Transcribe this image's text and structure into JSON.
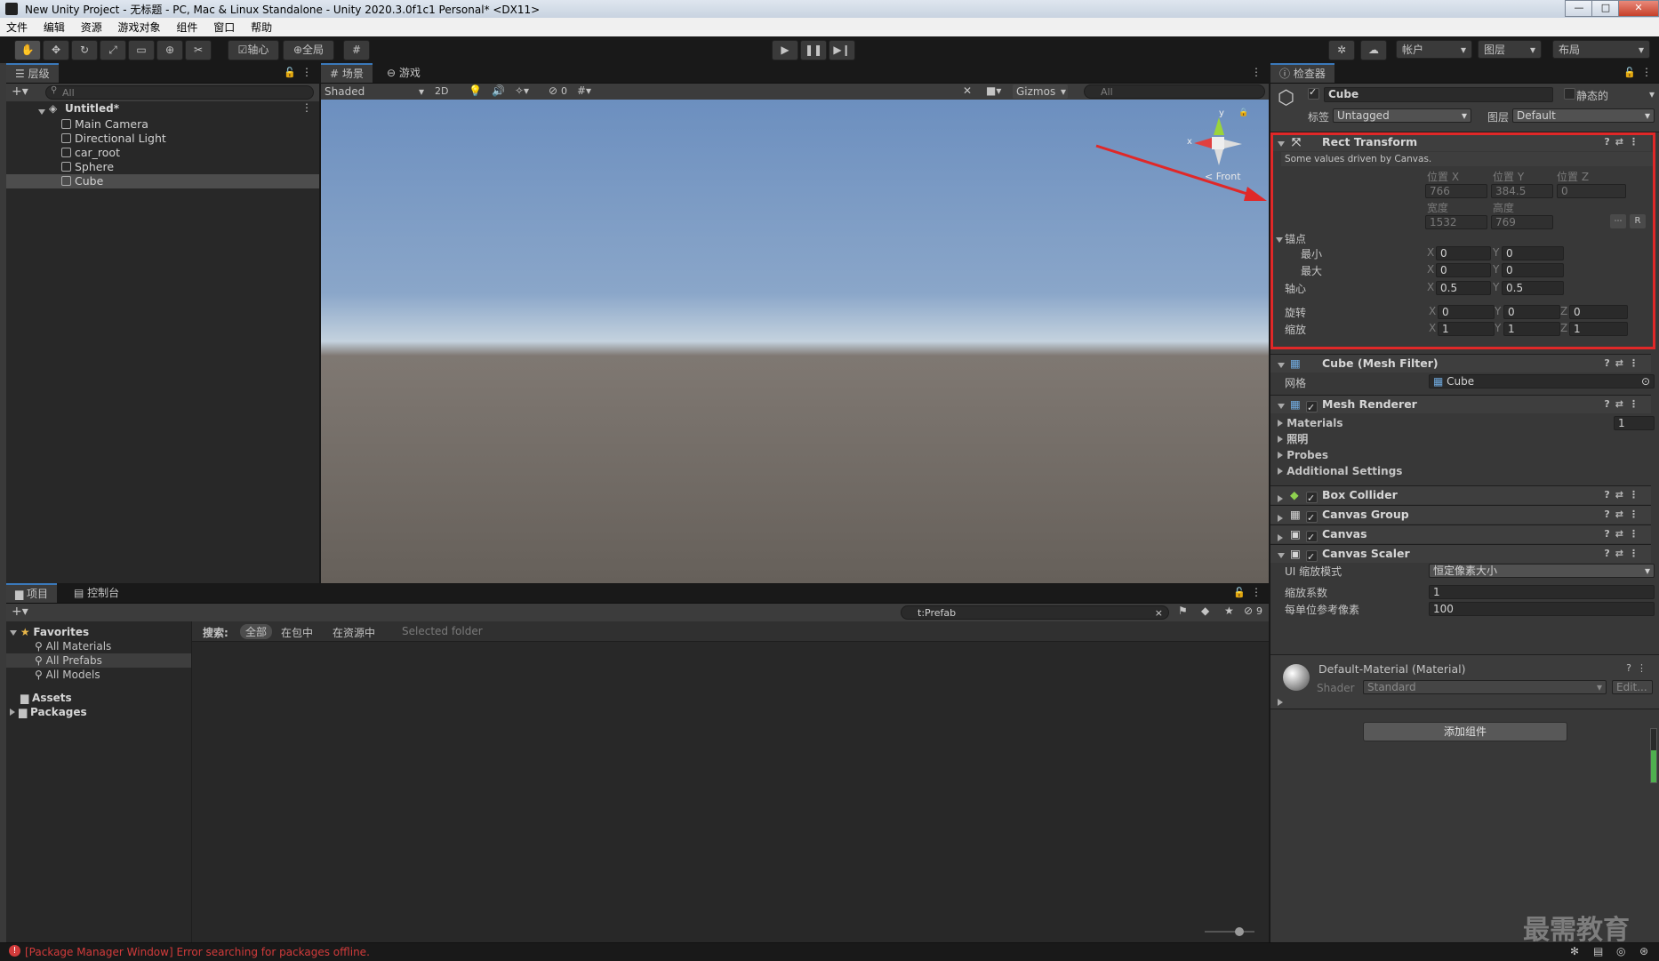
{
  "window": {
    "title": "New Unity Project - 无标题 - PC, Mac & Linux Standalone - Unity 2020.3.0f1c1 Personal* <DX11>",
    "minimize": "—",
    "maximize": "□",
    "close": "✕"
  },
  "menu": [
    "文件",
    "编辑",
    "资源",
    "游戏对象",
    "组件",
    "窗口",
    "帮助"
  ],
  "toolbar": {
    "pivot_label": "轴心",
    "global_label": "全局",
    "account_label": "帐户",
    "layers_label": "图层",
    "layout_label": "布局"
  },
  "hierarchy": {
    "tab_label": "层级",
    "search_placeholder": "All",
    "scene_name": "Untitled*",
    "items": [
      "Main Camera",
      "Directional Light",
      "car_root",
      "Sphere",
      "Cube"
    ]
  },
  "scene_view": {
    "tabs": [
      "场景",
      "游戏"
    ],
    "shading_mode": "Shaded",
    "mode_2d": "2D",
    "hidden_count": "0",
    "gizmos_label": "Gizmos",
    "search_placeholder": "All",
    "gizmo_y": "y",
    "gizmo_x": "x",
    "gizmo_view": "< Front"
  },
  "project": {
    "tabs": [
      "项目",
      "控制台"
    ],
    "search_value": "t:Prefab",
    "hidden_count": "9",
    "favorites_label": "Favorites",
    "favorites": [
      "All Materials",
      "All Prefabs",
      "All Models"
    ],
    "folders": [
      "Assets",
      "Packages"
    ],
    "search_label": "搜索:",
    "filters": [
      "全部",
      "在包中",
      "在资源中",
      "Selected folder"
    ]
  },
  "status_bar": {
    "error_text": "[Package Manager Window] Error searching for packages offline."
  },
  "watermark": "最需教育",
  "inspector": {
    "tab_label": "检查器",
    "object_name": "Cube",
    "static_label": "静态的",
    "tag_label": "标签",
    "tag_value": "Untagged",
    "layer_label": "图层",
    "layer_value": "Default",
    "rect_transform": {
      "title": "Rect Transform",
      "note": "Some values driven by Canvas.",
      "pos_x_label": "位置 X",
      "pos_y_label": "位置 Y",
      "pos_z_label": "位置 Z",
      "pos_x": "766",
      "pos_y": "384.5",
      "pos_z": "0",
      "width_label": "宽度",
      "height_label": "高度",
      "width": "1532",
      "height": "769",
      "r_button": "R",
      "anchors_label": "锚点",
      "min_label": "最小",
      "max_label": "最大",
      "min_x": "0",
      "min_y": "0",
      "max_x": "0",
      "max_y": "0",
      "pivot_label": "轴心",
      "pivot_x": "0.5",
      "pivot_y": "0.5",
      "rotation_label": "旋转",
      "rot_x": "0",
      "rot_y": "0",
      "rot_z": "0",
      "scale_label": "缩放",
      "scale_x": "1",
      "scale_y": "1",
      "scale_z": "1",
      "axis_x": "X",
      "axis_y": "Y",
      "axis_z": "Z"
    },
    "mesh_filter": {
      "title": "Cube (Mesh Filter)",
      "mesh_label": "网格",
      "mesh_value": "Cube"
    },
    "mesh_renderer": {
      "title": "Mesh Renderer",
      "materials_label": "Materials",
      "materials_count": "1",
      "lighting_label": "照明",
      "probes_label": "Probes",
      "additional_label": "Additional Settings"
    },
    "components": [
      "Box Collider",
      "Canvas Group",
      "Canvas",
      "Canvas Scaler"
    ],
    "canvas_scaler": {
      "ui_scale_label": "UI 缩放模式",
      "ui_scale_value": "恒定像素大小",
      "scale_factor_label": "缩放系数",
      "scale_factor_value": "1",
      "ref_pixels_label": "每单位参考像素",
      "ref_pixels_value": "100"
    },
    "material": {
      "title": "Default-Material (Material)",
      "shader_label": "Shader",
      "shader_value": "Standard",
      "edit_label": "Edit..."
    },
    "add_component_label": "添加组件"
  },
  "colors": {
    "highlight_red": "#e02828",
    "tab_accent": "#3a79bb",
    "error_red": "#d23b3b"
  }
}
